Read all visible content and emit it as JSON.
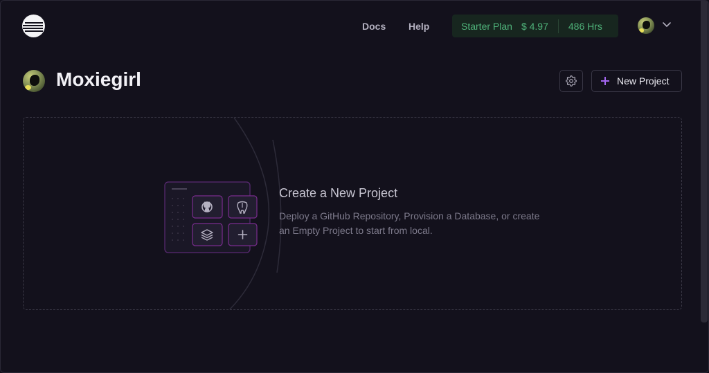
{
  "header": {
    "nav": [
      "Docs",
      "Help"
    ],
    "plan": {
      "name": "Starter Plan",
      "amount": "$ 4.97",
      "hours": "486 Hrs"
    },
    "colors": {
      "plan_text": "#4fb37a",
      "plan_bg": "#17261f",
      "accent": "#a466f0"
    }
  },
  "page": {
    "title": "Moxiegirl",
    "new_project_label": "New Project"
  },
  "empty_state": {
    "title": "Create a New Project",
    "description": "Deploy a GitHub Repository, Provision a Database, or create an Empty Project to start from local.",
    "icons": [
      "github-icon",
      "postgres-icon",
      "layers-icon",
      "plus-icon"
    ]
  }
}
